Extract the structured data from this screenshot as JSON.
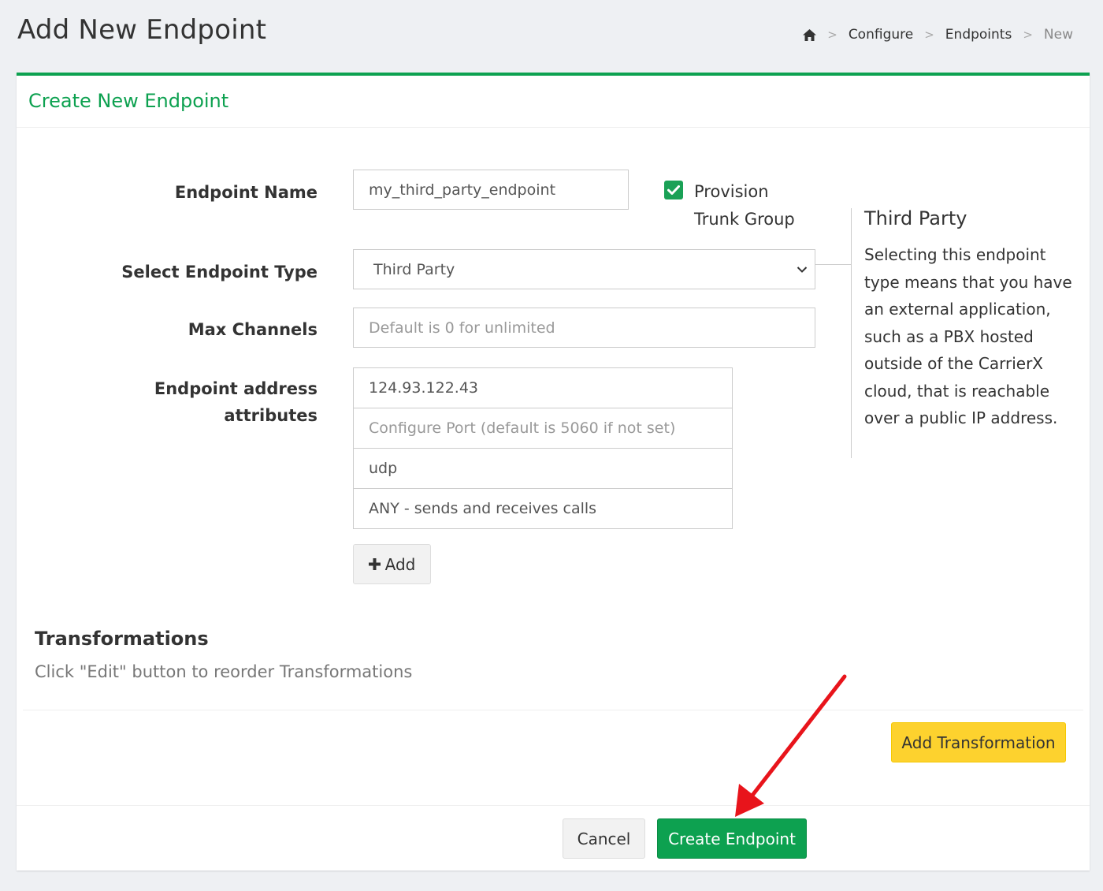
{
  "page": {
    "title": "Add New Endpoint"
  },
  "breadcrumb": {
    "home_icon": "home-icon",
    "separator": ">",
    "items": [
      "Configure",
      "Endpoints",
      "New"
    ]
  },
  "panel": {
    "title": "Create New Endpoint"
  },
  "form": {
    "endpoint_name": {
      "label": "Endpoint Name",
      "value": "my_third_party_endpoint"
    },
    "provision_trunk_group": {
      "label": "Provision Trunk Group",
      "checked": true
    },
    "endpoint_type": {
      "label": "Select Endpoint Type",
      "selected": "Third Party"
    },
    "max_channels": {
      "label": "Max Channels",
      "placeholder": "Default is 0 for unlimited"
    },
    "address_attributes": {
      "label": "Endpoint address attributes",
      "ip": "124.93.122.43",
      "port_placeholder": "Configure Port (default is 5060 if not set)",
      "transport": "udp",
      "direction": "ANY - sends and receives calls",
      "add_button": "Add"
    }
  },
  "help": {
    "title": "Third Party",
    "text": "Selecting this endpoint type means that you have an external application, such as a PBX hosted outside of the CarrierX cloud, that is reachable over a public IP address."
  },
  "transformations": {
    "title": "Transformations",
    "subtitle": "Click \"Edit\" button to reorder Transformations",
    "add_button": "Add Transformation"
  },
  "footer": {
    "cancel": "Cancel",
    "submit": "Create Endpoint"
  },
  "colors": {
    "brand_green": "#0da150",
    "warning_yellow": "#fdd22e",
    "annotation_red": "#e8141b"
  }
}
